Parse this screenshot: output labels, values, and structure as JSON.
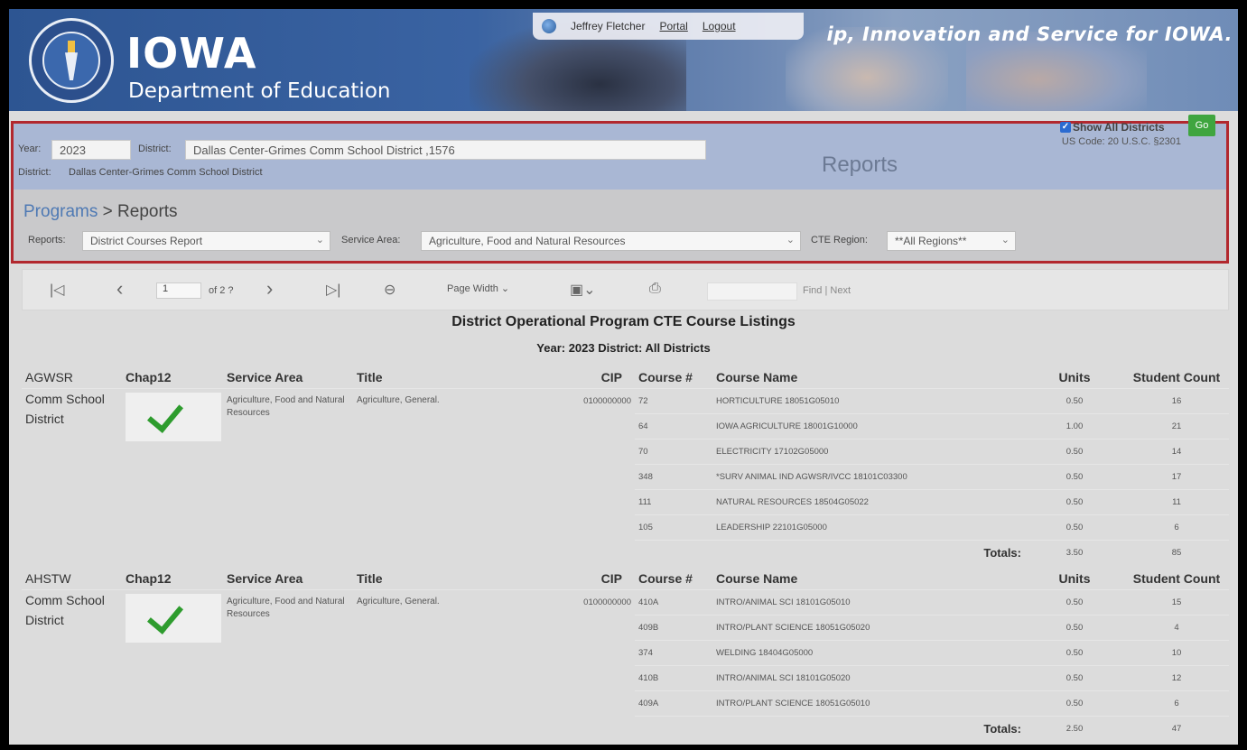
{
  "header": {
    "brand_name": "IOWA",
    "brand_sub": "Department of Education",
    "tagline": "ip, Innovation and Service for IOWA.",
    "user_name": "Jeffrey Fletcher",
    "portal_link": "Portal",
    "logout_link": "Logout"
  },
  "filters": {
    "year_label": "Year:",
    "year_value": "2023",
    "district_label": "District:",
    "district_value": "Dallas Center-Grimes Comm School District ,1576",
    "district_line_label": "District:",
    "district_line_value": "Dallas Center-Grimes Comm School District",
    "us_code": "US Code: 20 U.S.C. §2301",
    "page_heading": "Reports",
    "breadcrumb_link": "Programs",
    "breadcrumb_sep": ">",
    "breadcrumb_current": "Reports",
    "reports_label": "Reports:",
    "reports_value": "District Courses Report",
    "service_area_label": "Service Area:",
    "service_area_value": "Agriculture, Food and Natural Resources",
    "cte_region_label": "CTE Region:",
    "cte_region_value": "**All Regions**",
    "show_all_label": "Show All Districts",
    "go_label": "Go"
  },
  "toolbar": {
    "page_value": "1",
    "page_of": "of 2 ?",
    "zoom_value": "Page Width",
    "find_label": "Find",
    "next_label": "| Next"
  },
  "report": {
    "title": "District Operational Program CTE Course Listings",
    "subtitle": "Year: 2023 District:  All Districts",
    "columns": {
      "chap": "Chap12",
      "service_area": "Service Area",
      "title": "Title",
      "cip": "CIP",
      "course_num": "Course #",
      "course_name": "Course Name",
      "units": "Units",
      "student_count": "Student Count"
    },
    "totals_label": "Totals:",
    "districts": [
      {
        "name_top": "AGWSR",
        "name_rest": "Comm School District",
        "service_area": "Agriculture, Food and Natural Resources",
        "title": "Agriculture, General.",
        "cip": "0100000000",
        "courses": [
          {
            "num": "72",
            "name": "HORTICULTURE 18051G05010",
            "units": "0.50",
            "count": "16"
          },
          {
            "num": "64",
            "name": "IOWA AGRICULTURE 18001G10000",
            "units": "1.00",
            "count": "21"
          },
          {
            "num": "70",
            "name": "ELECTRICITY 17102G05000",
            "units": "0.50",
            "count": "14"
          },
          {
            "num": "348",
            "name": "*SURV ANIMAL IND AGWSR/IVCC 18101C03300",
            "units": "0.50",
            "count": "17"
          },
          {
            "num": "111",
            "name": "NATURAL RESOURCES 18504G05022",
            "units": "0.50",
            "count": "11"
          },
          {
            "num": "105",
            "name": "LEADERSHIP 22101G05000",
            "units": "0.50",
            "count": "6"
          }
        ],
        "total_units": "3.50",
        "total_count": "85"
      },
      {
        "name_top": "AHSTW",
        "name_rest": "Comm School District",
        "service_area": "Agriculture, Food and Natural Resources",
        "title": "Agriculture, General.",
        "cip": "0100000000",
        "courses": [
          {
            "num": "410A",
            "name": "INTRO/ANIMAL SCI 18101G05010",
            "units": "0.50",
            "count": "15"
          },
          {
            "num": "409B",
            "name": "INTRO/PLANT SCIENCE 18051G05020",
            "units": "0.50",
            "count": "4"
          },
          {
            "num": "374",
            "name": "WELDING 18404G05000",
            "units": "0.50",
            "count": "10"
          },
          {
            "num": "410B",
            "name": "INTRO/ANIMAL SCI 18101G05020",
            "units": "0.50",
            "count": "12"
          },
          {
            "num": "409A",
            "name": "INTRO/PLANT SCIENCE 18051G05010",
            "units": "0.50",
            "count": "6"
          }
        ],
        "total_units": "2.50",
        "total_count": "47"
      }
    ]
  },
  "colors": {
    "highlight_border": "#b2282e",
    "banner_blue": "#2d5592",
    "go_green": "#3fa53f",
    "check_green": "#2e9c2e"
  }
}
